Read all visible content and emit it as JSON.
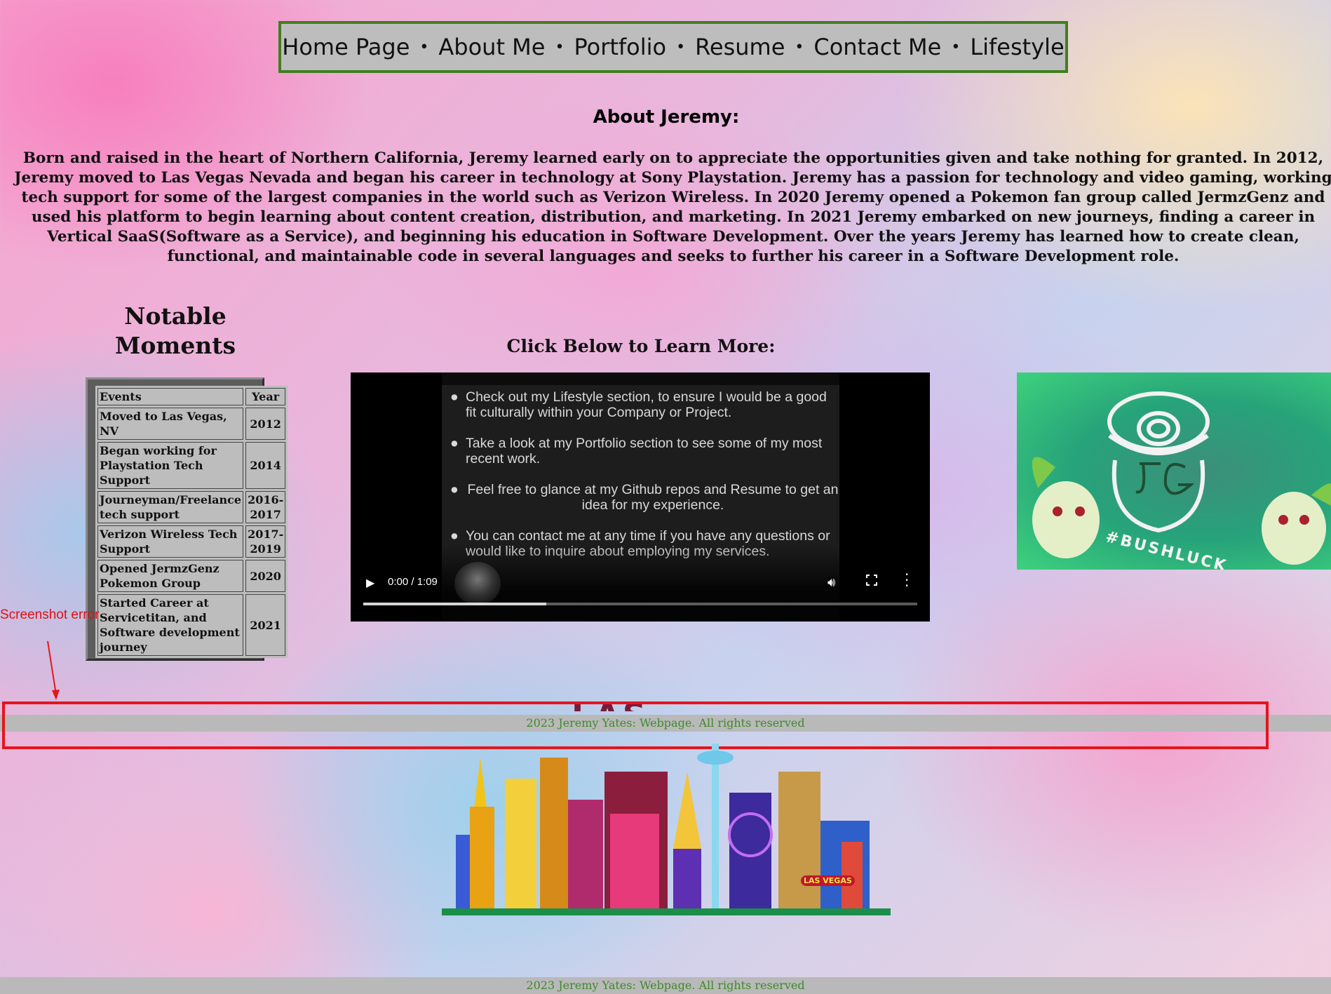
{
  "nav": {
    "items": [
      "Home Page",
      "About Me",
      "Portfolio",
      "Resume",
      "Contact Me",
      "Lifestyle"
    ],
    "separator": "•"
  },
  "about": {
    "title": "About Jeremy:",
    "bio": "Born and raised in the heart of Northern California, Jeremy learned early on to appreciate the opportunities given and take nothing for granted. In 2012, Jeremy moved to Las Vegas Nevada and began his career in technology at Sony Playstation. Jeremy has a passion for technology and video gaming, working tech support for some of the largest companies in the world such as Verizon Wireless. In 2020 Jeremy opened a Pokemon fan group called JermzGenz and used his platform to begin learning about content creation, distribution, and marketing. In 2021 Jeremy embarked on new journeys, finding a career in Vertical SaaS(Software as a Service), and beginning his education in Software Development. Over the years Jeremy has learned how to create clean, functional, and maintainable code in several languages and seeks to further his career in a Software Development role."
  },
  "notable": {
    "title": "Notable Moments",
    "headers": [
      "Events",
      "Year"
    ],
    "rows": [
      {
        "event": "Moved to Las Vegas, NV",
        "year": "2012"
      },
      {
        "event": "Began working for Playstation Tech Support",
        "year": "2014"
      },
      {
        "event": "Journeyman/Freelance tech support",
        "year": "2016-2017"
      },
      {
        "event": "Verizon Wireless Tech Support",
        "year": "2017-2019"
      },
      {
        "event": "Opened JermzGenz Pokemon Group",
        "year": "2020"
      },
      {
        "event": "Started Career at Servicetitan, and Software development journey",
        "year": "2021"
      }
    ]
  },
  "video": {
    "title": "Click Below to Learn More:",
    "bullets": [
      "Check out my Lifestyle section, to ensure I would be a good fit culturally within your Company or Project.",
      "Take a look at my Portfolio section to see some of my most recent work.",
      "Feel free to glance at my Github repos and Resume to get an idea for my experience.",
      "You can contact me at any time if you have any questions or would like to inquire about employing my services."
    ],
    "time": "0:00 / 1:09",
    "buffered_fraction": 0.33,
    "icons": [
      "play-icon",
      "volume-icon",
      "fullscreen-icon",
      "more-options-icon"
    ]
  },
  "logo": {
    "initials": "JG",
    "tagline": "#BUSHLUCK"
  },
  "annotation": {
    "label": "Screenshot error",
    "color": "#e3161c"
  },
  "skyline": {
    "sign": "LAS VEGAS",
    "banner": "LAS VEGAS"
  },
  "footer": {
    "text": "2023 Jeremy Yates: Webpage. All rights reserved"
  },
  "colors": {
    "nav_border": "#3f7f1f",
    "footer_text": "#3d8a2a",
    "footer_bg": "#b9b9b9"
  }
}
